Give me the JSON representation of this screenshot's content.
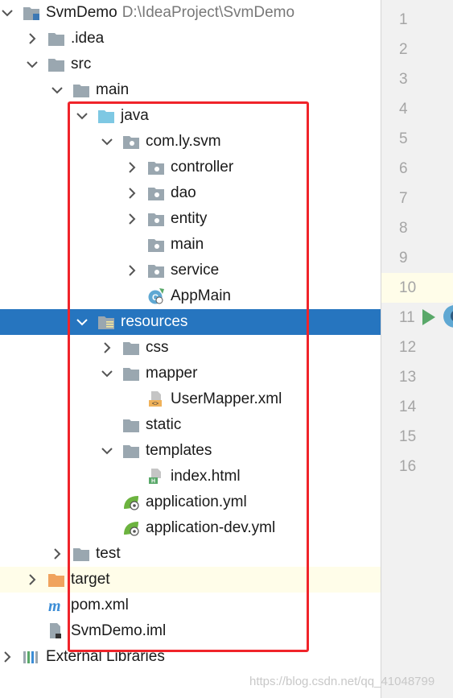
{
  "project": {
    "name": "SvmDemo",
    "path": "D:\\IdeaProject\\SvmDemo"
  },
  "tree": [
    {
      "id": "svmdemo",
      "label": "SvmDemo",
      "level": 0,
      "arrow": "down",
      "icon": "module-folder-icon"
    },
    {
      "id": "idea",
      "label": ".idea",
      "level": 1,
      "arrow": "right",
      "icon": "folder-icon"
    },
    {
      "id": "src",
      "label": "src",
      "level": 1,
      "arrow": "down",
      "icon": "folder-icon"
    },
    {
      "id": "main",
      "label": "main",
      "level": 2,
      "arrow": "down",
      "icon": "folder-icon"
    },
    {
      "id": "java",
      "label": "java",
      "level": 3,
      "arrow": "down",
      "icon": "source-folder-icon"
    },
    {
      "id": "com-ly-svm",
      "label": "com.ly.svm",
      "level": 4,
      "arrow": "down",
      "icon": "package-icon"
    },
    {
      "id": "controller",
      "label": "controller",
      "level": 5,
      "arrow": "right",
      "icon": "package-icon"
    },
    {
      "id": "dao",
      "label": "dao",
      "level": 5,
      "arrow": "right",
      "icon": "package-icon"
    },
    {
      "id": "entity",
      "label": "entity",
      "level": 5,
      "arrow": "right",
      "icon": "package-icon"
    },
    {
      "id": "main-pkg",
      "label": "main",
      "level": 5,
      "arrow": "none",
      "icon": "package-icon"
    },
    {
      "id": "service",
      "label": "service",
      "level": 5,
      "arrow": "right",
      "icon": "package-icon"
    },
    {
      "id": "appmain",
      "label": "AppMain",
      "level": 5,
      "arrow": "none",
      "icon": "spring-boot-class-icon"
    },
    {
      "id": "resources",
      "label": "resources",
      "level": 3,
      "arrow": "down",
      "icon": "resources-folder-icon",
      "selected": true
    },
    {
      "id": "css",
      "label": "css",
      "level": 4,
      "arrow": "right",
      "icon": "folder-icon"
    },
    {
      "id": "mapper",
      "label": "mapper",
      "level": 4,
      "arrow": "down",
      "icon": "folder-icon"
    },
    {
      "id": "usermapper",
      "label": "UserMapper.xml",
      "level": 5,
      "arrow": "none",
      "icon": "xml-file-icon"
    },
    {
      "id": "static",
      "label": "static",
      "level": 4,
      "arrow": "none",
      "icon": "folder-icon"
    },
    {
      "id": "templates",
      "label": "templates",
      "level": 4,
      "arrow": "down",
      "icon": "folder-icon"
    },
    {
      "id": "index-html",
      "label": "index.html",
      "level": 5,
      "arrow": "none",
      "icon": "html-file-icon"
    },
    {
      "id": "application-yml",
      "label": "application.yml",
      "level": 4,
      "arrow": "none",
      "icon": "spring-config-icon"
    },
    {
      "id": "application-dev-yml",
      "label": "application-dev.yml",
      "level": 4,
      "arrow": "none",
      "icon": "spring-config-icon"
    },
    {
      "id": "test",
      "label": "test",
      "level": 2,
      "arrow": "right",
      "icon": "folder-icon"
    },
    {
      "id": "target",
      "label": "target",
      "level": 1,
      "arrow": "right",
      "icon": "excluded-folder-icon",
      "highlighted": true
    },
    {
      "id": "pom",
      "label": "pom.xml",
      "level": 1,
      "arrow": "none",
      "icon": "maven-icon"
    },
    {
      "id": "iml",
      "label": "SvmDemo.iml",
      "level": 1,
      "arrow": "none",
      "icon": "iml-file-icon"
    },
    {
      "id": "external-libraries",
      "label": "External Libraries",
      "level": 0,
      "arrow": "right",
      "icon": "library-icon"
    }
  ],
  "line_numbers": [
    "1",
    "2",
    "3",
    "4",
    "5",
    "6",
    "7",
    "8",
    "9",
    "10",
    "11",
    "12",
    "13",
    "14",
    "15",
    "16"
  ],
  "current_line": "10",
  "gutter_icons": [
    "run-gutter-icon",
    "spring-bean-icon"
  ],
  "watermark": "https://blog.csdn.net/qq_41048799",
  "colors": {
    "selection": "#2675bf",
    "highlight_row": "#fffde9",
    "red_box": "#f0242a",
    "folder": "#9aa7b0",
    "source_folder": "#7ec8e3",
    "excluded_folder": "#f0a35e"
  }
}
